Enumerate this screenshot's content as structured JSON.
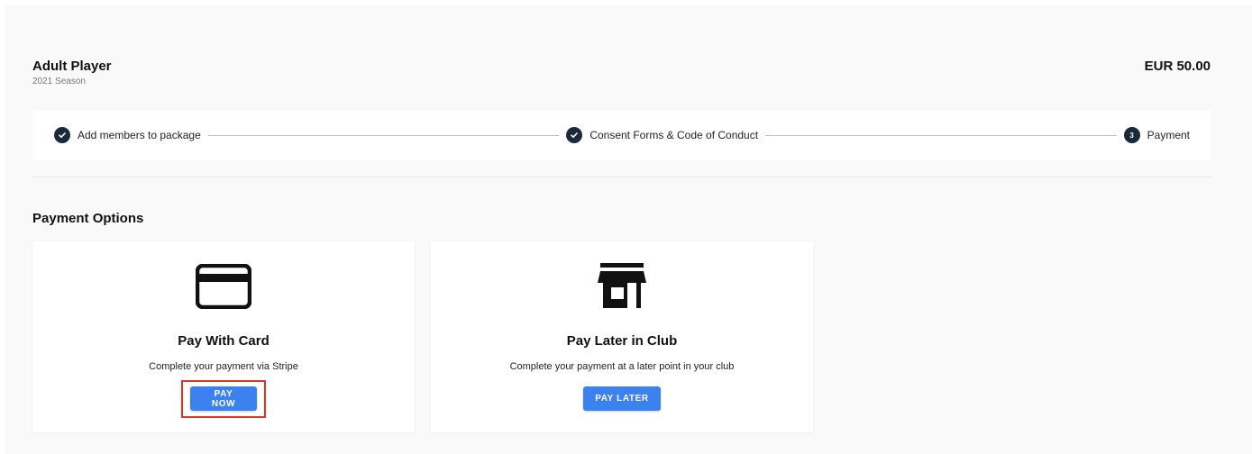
{
  "package": {
    "title": "Adult Player",
    "subtitle": "2021 Season",
    "price": "EUR 50.00"
  },
  "stepper": {
    "steps": [
      {
        "label": "Add members to package",
        "state": "completed",
        "icon": "check-circle-icon"
      },
      {
        "label": "Consent Forms & Code of Conduct",
        "state": "completed",
        "icon": "check-circle-icon"
      },
      {
        "label": "Payment",
        "state": "active",
        "number": "3"
      }
    ]
  },
  "payment": {
    "section_title": "Payment Options",
    "options": [
      {
        "icon": "credit-card-icon",
        "title": "Pay With Card",
        "description": "Complete your payment via Stripe",
        "button_label": "PAY NOW"
      },
      {
        "icon": "store-icon",
        "title": "Pay Later in Club",
        "description": "Complete your payment at a later point in your club",
        "button_label": "PAY LATER"
      }
    ]
  },
  "colors": {
    "primary_button": "#3b82f0",
    "step_icon": "#1b2a3a",
    "highlight": "#e0341f",
    "background": "#f9f9f9"
  }
}
